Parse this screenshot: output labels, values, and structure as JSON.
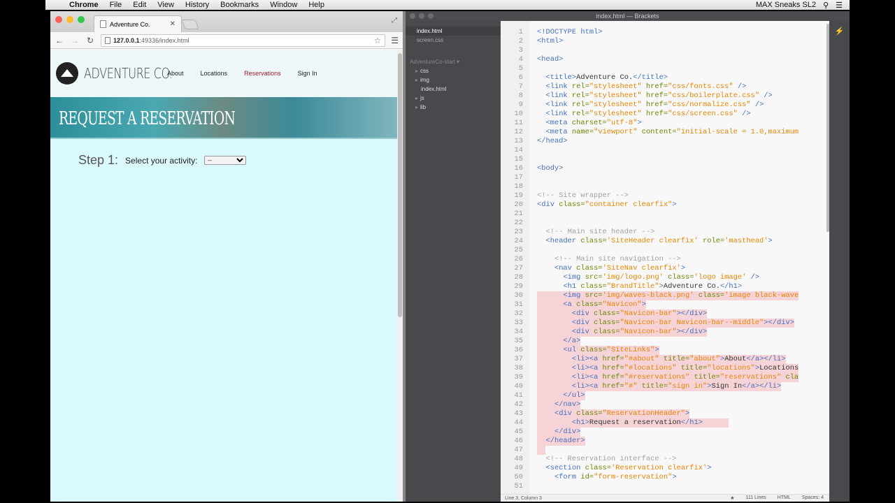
{
  "menubar": {
    "items": [
      "Chrome",
      "File",
      "Edit",
      "View",
      "History",
      "Bookmarks",
      "Window",
      "Help"
    ],
    "right": "MAX Sneaks SL2"
  },
  "chrome": {
    "tab_title": "Adventure Co.",
    "url_host": "127.0.0.1",
    "url_path": ":49336/index.html"
  },
  "site": {
    "brand": "Adventure Co.",
    "nav": [
      {
        "label": "About",
        "active": false
      },
      {
        "label": "Locations",
        "active": false
      },
      {
        "label": "Reservations",
        "active": true
      },
      {
        "label": "Sign In",
        "active": false
      }
    ],
    "header_title": "Request a reservation",
    "step_num": "Step 1:",
    "step_label": "Select your activity:",
    "select_value": "--"
  },
  "brackets": {
    "title": "index.html — Brackets",
    "working_files": [
      {
        "name": "index.html",
        "selected": true
      },
      {
        "name": "screen.css",
        "selected": false
      }
    ],
    "project": "AdventureCo-start ▾",
    "tree": [
      {
        "name": "css",
        "folder": true
      },
      {
        "name": "img",
        "folder": true
      },
      {
        "name": "index.html",
        "folder": false
      },
      {
        "name": "js",
        "folder": true
      },
      {
        "name": "lib",
        "folder": true
      }
    ],
    "status_left": "Line 3, Column 3",
    "status_lines": "111 Lines",
    "status_mode": "HTML",
    "status_spaces": "Spaces: 4"
  },
  "code_lines": [
    {
      "n": "1",
      "s": false,
      "c": [
        [
          "tag",
          "<!DOCTYPE html>"
        ]
      ]
    },
    {
      "n": "2",
      "s": false,
      "c": [
        [
          "tag",
          "<html>"
        ]
      ]
    },
    {
      "n": "3",
      "s": false,
      "c": []
    },
    {
      "n": "4",
      "s": false,
      "c": [
        [
          "tag",
          "<head>"
        ]
      ]
    },
    {
      "n": "5",
      "s": false,
      "c": []
    },
    {
      "n": "6",
      "s": false,
      "c": [
        [
          "txt",
          "  "
        ],
        [
          "tag",
          "<title>"
        ],
        [
          "txt",
          "Adventure Co."
        ],
        [
          "tag",
          "</title>"
        ]
      ]
    },
    {
      "n": "7",
      "s": false,
      "c": [
        [
          "txt",
          "  "
        ],
        [
          "tag",
          "<link "
        ],
        [
          "attr",
          "rel="
        ],
        [
          "str",
          "\"stylesheet\""
        ],
        [
          "attr",
          " href="
        ],
        [
          "str",
          "\"css/fonts.css\""
        ],
        [
          "tag",
          " />"
        ]
      ]
    },
    {
      "n": "8",
      "s": false,
      "c": [
        [
          "txt",
          "  "
        ],
        [
          "tag",
          "<link "
        ],
        [
          "attr",
          "rel="
        ],
        [
          "str",
          "\"stylesheet\""
        ],
        [
          "attr",
          " href="
        ],
        [
          "str",
          "\"css/boilerplate.css\""
        ],
        [
          "tag",
          " />"
        ]
      ]
    },
    {
      "n": "9",
      "s": false,
      "c": [
        [
          "txt",
          "  "
        ],
        [
          "tag",
          "<link "
        ],
        [
          "attr",
          "rel="
        ],
        [
          "str",
          "\"stylesheet\""
        ],
        [
          "attr",
          " href="
        ],
        [
          "str",
          "\"css/normalize.css\""
        ],
        [
          "tag",
          " />"
        ]
      ]
    },
    {
      "n": "10",
      "s": false,
      "c": [
        [
          "txt",
          "  "
        ],
        [
          "tag",
          "<link "
        ],
        [
          "attr",
          "rel="
        ],
        [
          "str",
          "\"stylesheet\""
        ],
        [
          "attr",
          " href="
        ],
        [
          "str",
          "\"css/screen.css\""
        ],
        [
          "tag",
          " />"
        ]
      ]
    },
    {
      "n": "11",
      "s": false,
      "c": [
        [
          "txt",
          "  "
        ],
        [
          "tag",
          "<meta "
        ],
        [
          "attr",
          "charset="
        ],
        [
          "str",
          "\"utf-8\""
        ],
        [
          "tag",
          ">"
        ]
      ]
    },
    {
      "n": "12",
      "s": false,
      "c": [
        [
          "txt",
          "  "
        ],
        [
          "tag",
          "<meta "
        ],
        [
          "attr",
          "name="
        ],
        [
          "str",
          "\"viewport\""
        ],
        [
          "attr",
          " content="
        ],
        [
          "str",
          "\"initial-scale = 1.0,maximum"
        ]
      ]
    },
    {
      "n": "13",
      "s": false,
      "c": [
        [
          "tag",
          "</head>"
        ]
      ]
    },
    {
      "n": "14",
      "s": false,
      "c": []
    },
    {
      "n": "15",
      "s": false,
      "c": []
    },
    {
      "n": "16",
      "s": false,
      "c": [
        [
          "tag",
          "<body>"
        ]
      ]
    },
    {
      "n": "17",
      "s": false,
      "c": []
    },
    {
      "n": "18",
      "s": false,
      "c": []
    },
    {
      "n": "19",
      "s": false,
      "c": [
        [
          "cmt",
          "<!-- Site wrapper -->"
        ]
      ]
    },
    {
      "n": "20",
      "s": false,
      "c": [
        [
          "tag",
          "<div "
        ],
        [
          "attr",
          "class="
        ],
        [
          "str",
          "\"container clearfix\""
        ],
        [
          "tag",
          ">"
        ]
      ]
    },
    {
      "n": "21",
      "s": false,
      "c": []
    },
    {
      "n": "22",
      "s": false,
      "c": []
    },
    {
      "n": "23",
      "s": false,
      "c": [
        [
          "txt",
          "  "
        ],
        [
          "cmt",
          "<!-- Main site header -->"
        ]
      ]
    },
    {
      "n": "24",
      "s": false,
      "c": [
        [
          "txt",
          "  "
        ],
        [
          "tag",
          "<header "
        ],
        [
          "attr",
          "class="
        ],
        [
          "str",
          "'SiteHeader clearfix'"
        ],
        [
          "attr",
          " role="
        ],
        [
          "str",
          "'masthead'"
        ],
        [
          "tag",
          ">"
        ]
      ]
    },
    {
      "n": "25",
      "s": false,
      "c": []
    },
    {
      "n": "26",
      "s": false,
      "c": [
        [
          "txt",
          "    "
        ],
        [
          "cmt",
          "<!-- Main site navigation -->"
        ]
      ]
    },
    {
      "n": "27",
      "s": false,
      "c": [
        [
          "txt",
          "    "
        ],
        [
          "tag",
          "<nav "
        ],
        [
          "attr",
          "class="
        ],
        [
          "str",
          "'SiteNav clearfix'"
        ],
        [
          "tag",
          ">"
        ]
      ]
    },
    {
      "n": "28",
      "s": false,
      "c": [
        [
          "txt",
          "      "
        ],
        [
          "tag",
          "<img "
        ],
        [
          "attr",
          "src="
        ],
        [
          "str",
          "'img/logo.png'"
        ],
        [
          "attr",
          " class="
        ],
        [
          "str",
          "'logo image'"
        ],
        [
          "tag",
          " />"
        ]
      ]
    },
    {
      "n": "29",
      "s": false,
      "c": [
        [
          "txt",
          "      "
        ],
        [
          "tag",
          "<h1 "
        ],
        [
          "attr",
          "class="
        ],
        [
          "str",
          "\"BrandTitle\""
        ],
        [
          "tag",
          ">"
        ],
        [
          "txt",
          "Adventure Co."
        ],
        [
          "tag",
          "</h1>"
        ]
      ]
    },
    {
      "n": "30",
      "s": true,
      "c": [
        [
          "txt",
          "      "
        ],
        [
          "tag",
          "<img "
        ],
        [
          "attr",
          "src="
        ],
        [
          "str",
          "'img/waves-black.png'"
        ],
        [
          "attr",
          " class="
        ],
        [
          "str",
          "'image black-wave"
        ]
      ]
    },
    {
      "n": "31",
      "s": true,
      "c": [
        [
          "txt",
          "      "
        ],
        [
          "tag",
          "<a "
        ],
        [
          "attr",
          "class="
        ],
        [
          "str",
          "\"Navicon\""
        ],
        [
          "tag",
          ">"
        ]
      ]
    },
    {
      "n": "32",
      "s": true,
      "c": [
        [
          "txt",
          "        "
        ],
        [
          "tag",
          "<div "
        ],
        [
          "attr",
          "class="
        ],
        [
          "str",
          "\"Navicon-bar\""
        ],
        [
          "tag",
          "></div>"
        ]
      ]
    },
    {
      "n": "33",
      "s": true,
      "c": [
        [
          "txt",
          "        "
        ],
        [
          "tag",
          "<div "
        ],
        [
          "attr",
          "class="
        ],
        [
          "str",
          "\"Navicon-bar Navicon-bar--middle\""
        ],
        [
          "tag",
          "></div>"
        ]
      ]
    },
    {
      "n": "34",
      "s": true,
      "c": [
        [
          "txt",
          "        "
        ],
        [
          "tag",
          "<div "
        ],
        [
          "attr",
          "class="
        ],
        [
          "str",
          "\"Navicon-bar\""
        ],
        [
          "tag",
          "></div>"
        ]
      ]
    },
    {
      "n": "35",
      "s": true,
      "c": [
        [
          "txt",
          "      "
        ],
        [
          "tag",
          "</a>"
        ]
      ]
    },
    {
      "n": "36",
      "s": true,
      "c": [
        [
          "txt",
          "      "
        ],
        [
          "tag",
          "<ul "
        ],
        [
          "attr",
          "class="
        ],
        [
          "str",
          "\"SiteLinks\""
        ],
        [
          "tag",
          ">"
        ]
      ]
    },
    {
      "n": "37",
      "s": true,
      "c": [
        [
          "txt",
          "        "
        ],
        [
          "tag",
          "<li><a "
        ],
        [
          "attr",
          "href="
        ],
        [
          "str",
          "\"#about\""
        ],
        [
          "attr",
          " title="
        ],
        [
          "str",
          "\"about\""
        ],
        [
          "tag",
          ">"
        ],
        [
          "txt",
          "About"
        ],
        [
          "tag",
          "</a></li>"
        ]
      ]
    },
    {
      "n": "38",
      "s": true,
      "c": [
        [
          "txt",
          "        "
        ],
        [
          "tag",
          "<li><a "
        ],
        [
          "attr",
          "href="
        ],
        [
          "str",
          "\"#locations\""
        ],
        [
          "attr",
          " title="
        ],
        [
          "str",
          "\"locations\""
        ],
        [
          "tag",
          ">"
        ],
        [
          "txt",
          "Locations"
        ]
      ]
    },
    {
      "n": "39",
      "s": true,
      "c": [
        [
          "txt",
          "        "
        ],
        [
          "tag",
          "<li><a "
        ],
        [
          "attr",
          "href="
        ],
        [
          "str",
          "\"#reservations\""
        ],
        [
          "attr",
          " title="
        ],
        [
          "str",
          "\"reservations\""
        ],
        [
          "attr",
          " cla"
        ]
      ]
    },
    {
      "n": "40",
      "s": true,
      "c": [
        [
          "txt",
          "        "
        ],
        [
          "tag",
          "<li><a "
        ],
        [
          "attr",
          "href="
        ],
        [
          "str",
          "\"#\""
        ],
        [
          "attr",
          " title="
        ],
        [
          "str",
          "\"sign in\""
        ],
        [
          "tag",
          ">"
        ],
        [
          "txt",
          "Sign In"
        ],
        [
          "tag",
          "</a></li>"
        ]
      ]
    },
    {
      "n": "41",
      "s": true,
      "c": [
        [
          "txt",
          "      "
        ],
        [
          "tag",
          "</ul>"
        ]
      ]
    },
    {
      "n": "42",
      "s": true,
      "c": [
        [
          "txt",
          "    "
        ],
        [
          "tag",
          "</nav>"
        ]
      ]
    },
    {
      "n": "43",
      "s": true,
      "c": [
        [
          "txt",
          "    "
        ],
        [
          "tag",
          "<div "
        ],
        [
          "attr",
          "class="
        ],
        [
          "str",
          "\"ReservationHeader\""
        ],
        [
          "tag",
          ">"
        ]
      ]
    },
    {
      "n": "44",
      "s": true,
      "c": [
        [
          "txt",
          "        "
        ],
        [
          "tag",
          "<h1>"
        ],
        [
          "txt",
          "Request a reservation"
        ],
        [
          "tag",
          "</h1>"
        ],
        [
          "txt",
          "      "
        ]
      ]
    },
    {
      "n": "45",
      "s": true,
      "c": [
        [
          "txt",
          "    "
        ],
        [
          "tag",
          "</div>"
        ]
      ]
    },
    {
      "n": "46",
      "s": true,
      "c": [
        [
          "txt",
          "  "
        ],
        [
          "tag",
          "</header>"
        ]
      ]
    },
    {
      "n": "47",
      "s": true,
      "c": [
        [
          "txt",
          "  "
        ]
      ]
    },
    {
      "n": "48",
      "s": false,
      "c": [
        [
          "txt",
          "  "
        ],
        [
          "cmt",
          "<!-- Reservation interface -->"
        ]
      ]
    },
    {
      "n": "49",
      "s": false,
      "c": [
        [
          "txt",
          "  "
        ],
        [
          "tag",
          "<section "
        ],
        [
          "attr",
          "class="
        ],
        [
          "str",
          "'Reservation clearfix'"
        ],
        [
          "tag",
          ">"
        ]
      ]
    },
    {
      "n": "50",
      "s": false,
      "c": [
        [
          "txt",
          "    "
        ],
        [
          "tag",
          "<form "
        ],
        [
          "attr",
          "id="
        ],
        [
          "str",
          "\"form-reservation\""
        ],
        [
          "tag",
          ">"
        ]
      ]
    },
    {
      "n": "51",
      "s": false,
      "c": []
    }
  ]
}
